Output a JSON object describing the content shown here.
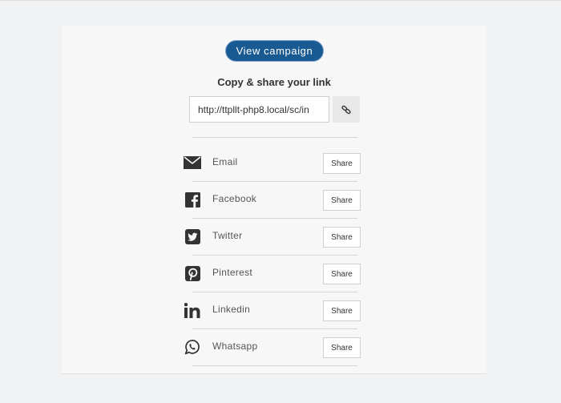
{
  "campaign": {
    "view_label": "View campaign"
  },
  "copy_section": {
    "title": "Copy & share your link",
    "link_value": "http://ttpllt-php8.local/sc/in"
  },
  "share_rows": [
    {
      "label": "Email",
      "button": "Share",
      "icon": "email-icon"
    },
    {
      "label": "Facebook",
      "button": "Share",
      "icon": "facebook-icon"
    },
    {
      "label": "Twitter",
      "button": "Share",
      "icon": "twitter-icon"
    },
    {
      "label": "Pinterest",
      "button": "Share",
      "icon": "pinterest-icon"
    },
    {
      "label": "Linkedin",
      "button": "Share",
      "icon": "linkedin-icon"
    },
    {
      "label": "Whatsapp",
      "button": "Share",
      "icon": "whatsapp-icon"
    }
  ],
  "colors": {
    "accent": "#1a5a93",
    "icon": "#333333"
  }
}
